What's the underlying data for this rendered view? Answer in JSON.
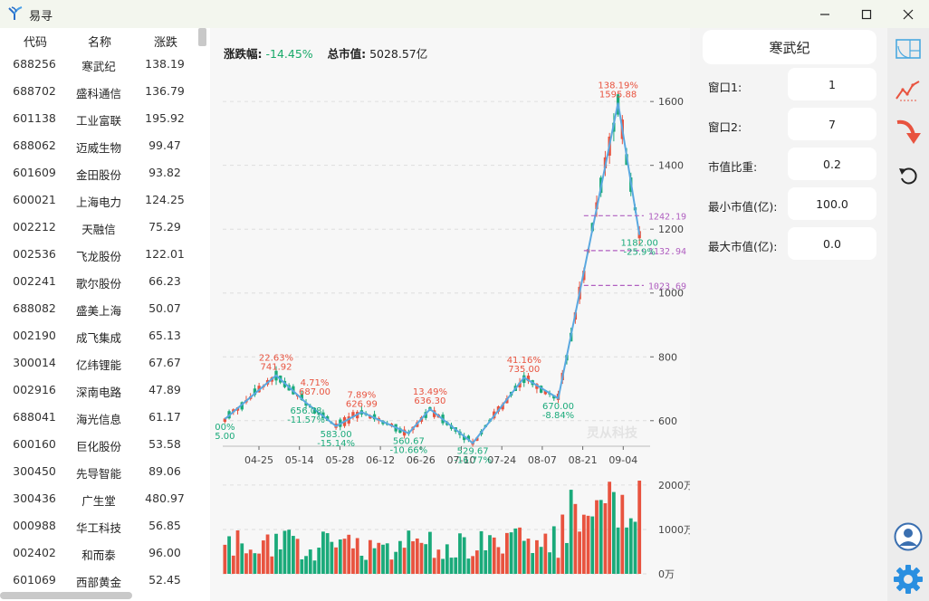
{
  "window": {
    "title": "易寻"
  },
  "list": {
    "headers": {
      "code": "代码",
      "name": "名称",
      "change": "涨跌"
    },
    "rows": [
      {
        "code": "688256",
        "name": "寒武纪",
        "change": "138.19"
      },
      {
        "code": "688702",
        "name": "盛科通信",
        "change": "136.79"
      },
      {
        "code": "601138",
        "name": "工业富联",
        "change": "195.92"
      },
      {
        "code": "688062",
        "name": "迈威生物",
        "change": "99.47"
      },
      {
        "code": "601609",
        "name": "金田股份",
        "change": "93.82"
      },
      {
        "code": "600021",
        "name": "上海电力",
        "change": "124.25"
      },
      {
        "code": "002212",
        "name": "天融信",
        "change": "75.29"
      },
      {
        "code": "002536",
        "name": "飞龙股份",
        "change": "122.01"
      },
      {
        "code": "002241",
        "name": "歌尔股份",
        "change": "66.23"
      },
      {
        "code": "688082",
        "name": "盛美上海",
        "change": "50.07"
      },
      {
        "code": "002190",
        "name": "成飞集成",
        "change": "65.13"
      },
      {
        "code": "300014",
        "name": "亿纬锂能",
        "change": "67.67"
      },
      {
        "code": "002916",
        "name": "深南电路",
        "change": "47.89"
      },
      {
        "code": "688041",
        "name": "海光信息",
        "change": "61.17"
      },
      {
        "code": "600160",
        "name": "巨化股份",
        "change": "53.58"
      },
      {
        "code": "300450",
        "name": "先导智能",
        "change": "89.06"
      },
      {
        "code": "300436",
        "name": "广生堂",
        "change": "480.97"
      },
      {
        "code": "000988",
        "name": "华工科技",
        "change": "56.85"
      },
      {
        "code": "002402",
        "name": "和而泰",
        "change": "96.00"
      },
      {
        "code": "601069",
        "name": "西部黄金",
        "change": "52.45"
      }
    ]
  },
  "chart": {
    "change_label": "涨跌幅:",
    "change_value": "-14.45%",
    "mcap_label": "总市值:",
    "mcap_value": "5028.57亿",
    "watermark": "灵从科技"
  },
  "chart_data": {
    "type": "candlestick",
    "x_ticks": [
      "04-25",
      "05-14",
      "05-28",
      "06-12",
      "06-26",
      "07-10",
      "07-24",
      "08-07",
      "08-21",
      "09-04"
    ],
    "y_ticks": [
      "600",
      "800",
      "1000",
      "1200",
      "1400",
      "1600"
    ],
    "ylim": [
      520,
      1660
    ],
    "volume_ticks": [
      "0万",
      "1000万",
      "2000万"
    ],
    "volume_ylim": [
      0,
      2100
    ],
    "zigzag": [
      {
        "i": 0,
        "v": 605
      },
      {
        "i": 12,
        "v": 741.92
      },
      {
        "i": 19,
        "v": 656.08
      },
      {
        "i": 26,
        "v": 583.0
      },
      {
        "i": 32,
        "v": 626.99
      },
      {
        "i": 43,
        "v": 560.67
      },
      {
        "i": 48,
        "v": 636.3
      },
      {
        "i": 58,
        "v": 529.67
      },
      {
        "i": 70,
        "v": 735.0
      },
      {
        "i": 78,
        "v": 670.0
      },
      {
        "i": 92,
        "v": 1595.88
      },
      {
        "i": 97,
        "v": 1182.0
      }
    ],
    "peak_labels": [
      {
        "i": 0,
        "pct": "5.00",
        "price": "00%",
        "color": "green"
      },
      {
        "i": 12,
        "pct": "22.63%",
        "price": "741.92",
        "color": "red"
      },
      {
        "i": 19,
        "pct": "-11.57%",
        "price": "656.08",
        "color": "green"
      },
      {
        "i": 21,
        "pct": "4.71%",
        "price": "687.00",
        "color": "red"
      },
      {
        "i": 26,
        "pct": "-15.14%",
        "price": "583.00",
        "color": "green"
      },
      {
        "i": 32,
        "pct": "7.89%",
        "price": "626.99",
        "color": "red"
      },
      {
        "i": 43,
        "pct": "-10.66%",
        "price": "560.67",
        "color": "green"
      },
      {
        "i": 48,
        "pct": "13.49%",
        "price": "636.30",
        "color": "red"
      },
      {
        "i": 58,
        "pct": "-16.77%",
        "price": "529.67",
        "color": "green"
      },
      {
        "i": 70,
        "pct": "41.16%",
        "price": "735.00",
        "color": "red"
      },
      {
        "i": 78,
        "pct": "-8.84%",
        "price": "670.00",
        "color": "green"
      },
      {
        "i": 92,
        "pct": "138.19%",
        "price": "1595.88",
        "color": "red"
      },
      {
        "i": 97,
        "pct": "-25.9%",
        "price": "1182.00",
        "color": "green"
      }
    ],
    "levels": [
      {
        "value": 1242.19,
        "label": "1242.19"
      },
      {
        "value": 1132.94,
        "label": "1132.94"
      },
      {
        "value": 1023.69,
        "label": "1023.69"
      }
    ],
    "colors": {
      "up": "#e8533f",
      "down": "#1aaa7a",
      "zigzag": "#5aa8e0",
      "level": "#b05fc0"
    }
  },
  "params": {
    "stock_name": "寒武纪",
    "items": [
      {
        "label": "窗口1:",
        "value": "1"
      },
      {
        "label": "窗口2:",
        "value": "7"
      },
      {
        "label": "市值比重:",
        "value": "0.2"
      },
      {
        "label": "最小市值(亿):",
        "value": "100.0"
      },
      {
        "label": "最大市值(亿):",
        "value": "0.0"
      }
    ]
  },
  "tools": [
    "golden-ratio-icon",
    "zigzag-trend-icon",
    "down-arrow-icon",
    "refresh-icon",
    "user-avatar-icon",
    "settings-gear-icon"
  ]
}
